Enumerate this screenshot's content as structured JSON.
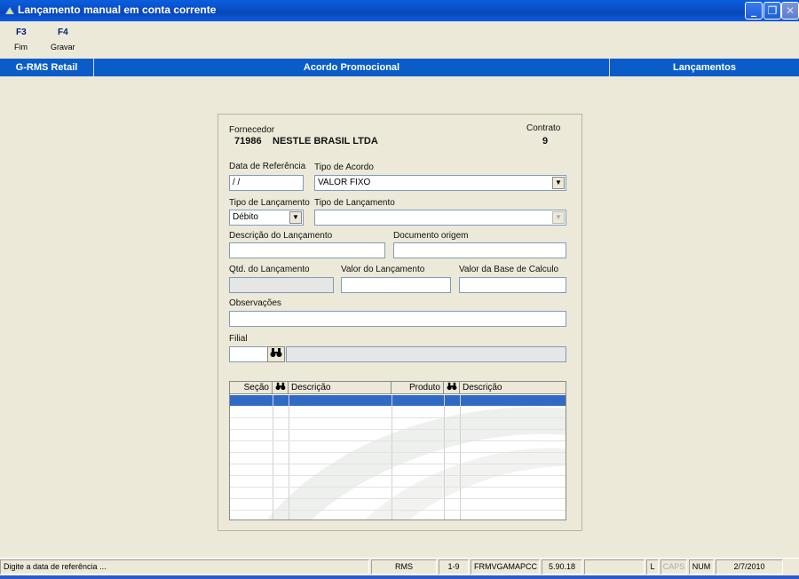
{
  "window": {
    "title": "Lançamento manual em conta corrente",
    "buttons": {
      "minimize": "_",
      "restore": "❐",
      "close": "✕"
    }
  },
  "toolbar": [
    {
      "key": "F3",
      "label": "Fim"
    },
    {
      "key": "F4",
      "label": "Gravar"
    }
  ],
  "header": {
    "left": "G-RMS Retail",
    "center": "Acordo Promocional",
    "right": "Lançamentos"
  },
  "form": {
    "fornecedor_label": "Fornecedor",
    "fornecedor_codigo": "71986",
    "fornecedor_nome": "NESTLE BRASIL LTDA",
    "contrato_label": "Contrato",
    "contrato_valor": "9",
    "data_referencia_label": "Data de Referência",
    "data_referencia_value": " / /",
    "tipo_acordo_label": "Tipo de  Acordo",
    "tipo_acordo_value": "VALOR FIXO",
    "tipo_lancamento_label": "Tipo de Lançamento",
    "tipo_lancamento_value": "Débito",
    "tipo_lancamento2_label": "Tipo de Lançamento",
    "tipo_lancamento2_value": "",
    "descricao_label": "Descrição do Lançamento",
    "documento_label": "Documento origem",
    "qtd_label": "Qtd. do Lançamento",
    "valor_label": "Valor do Lançamento",
    "base_label": "Valor da Base de Calculo",
    "observacoes_label": "Observações",
    "filial_label": "Filial"
  },
  "grid": {
    "columns": [
      "Seção",
      "Descrição",
      "Produto",
      "Descrição"
    ]
  },
  "statusbar": {
    "message": "Digite a data de referência ...",
    "system": "RMS",
    "range": "1-9",
    "form_name": "FRMVGAMAPCC",
    "version": "5.90.18",
    "empty": "",
    "l": "L",
    "caps": "CAPS",
    "num": "NUM",
    "date": "2/7/2010"
  },
  "colors": {
    "titlebar": "#0a4fc8",
    "headerbar": "#0a5dc8",
    "selection": "#316ac5",
    "background": "#ece9d8"
  }
}
